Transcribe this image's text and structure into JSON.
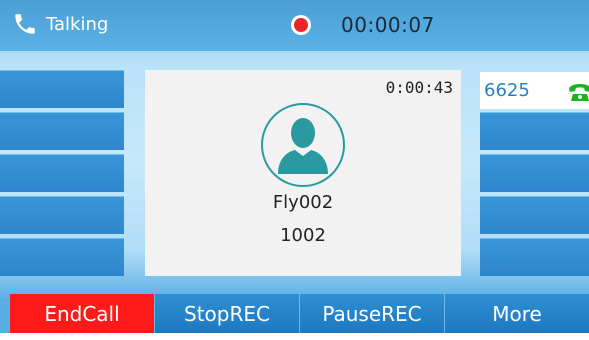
{
  "status": {
    "label": "Talking",
    "icon": "phone-handset-icon",
    "recording_timer": "00:00:07",
    "recording_icon": "record-dot-icon",
    "recording_color": "#e8262a"
  },
  "call": {
    "duration": "0:00:43",
    "contact_name": "Fly002",
    "contact_number": "1002",
    "avatar_icon": "contact-avatar-icon"
  },
  "right_keys": {
    "account_label": "6625",
    "account_icon": "registered-line-icon"
  },
  "softkeys": {
    "end_call": "EndCall",
    "stop_rec": "StopREC",
    "pause_rec": "PauseREC",
    "more": "More"
  },
  "colors": {
    "accent": "#2f86cc",
    "danger": "#ff1a1a",
    "avatar": "#2a9aa0"
  }
}
